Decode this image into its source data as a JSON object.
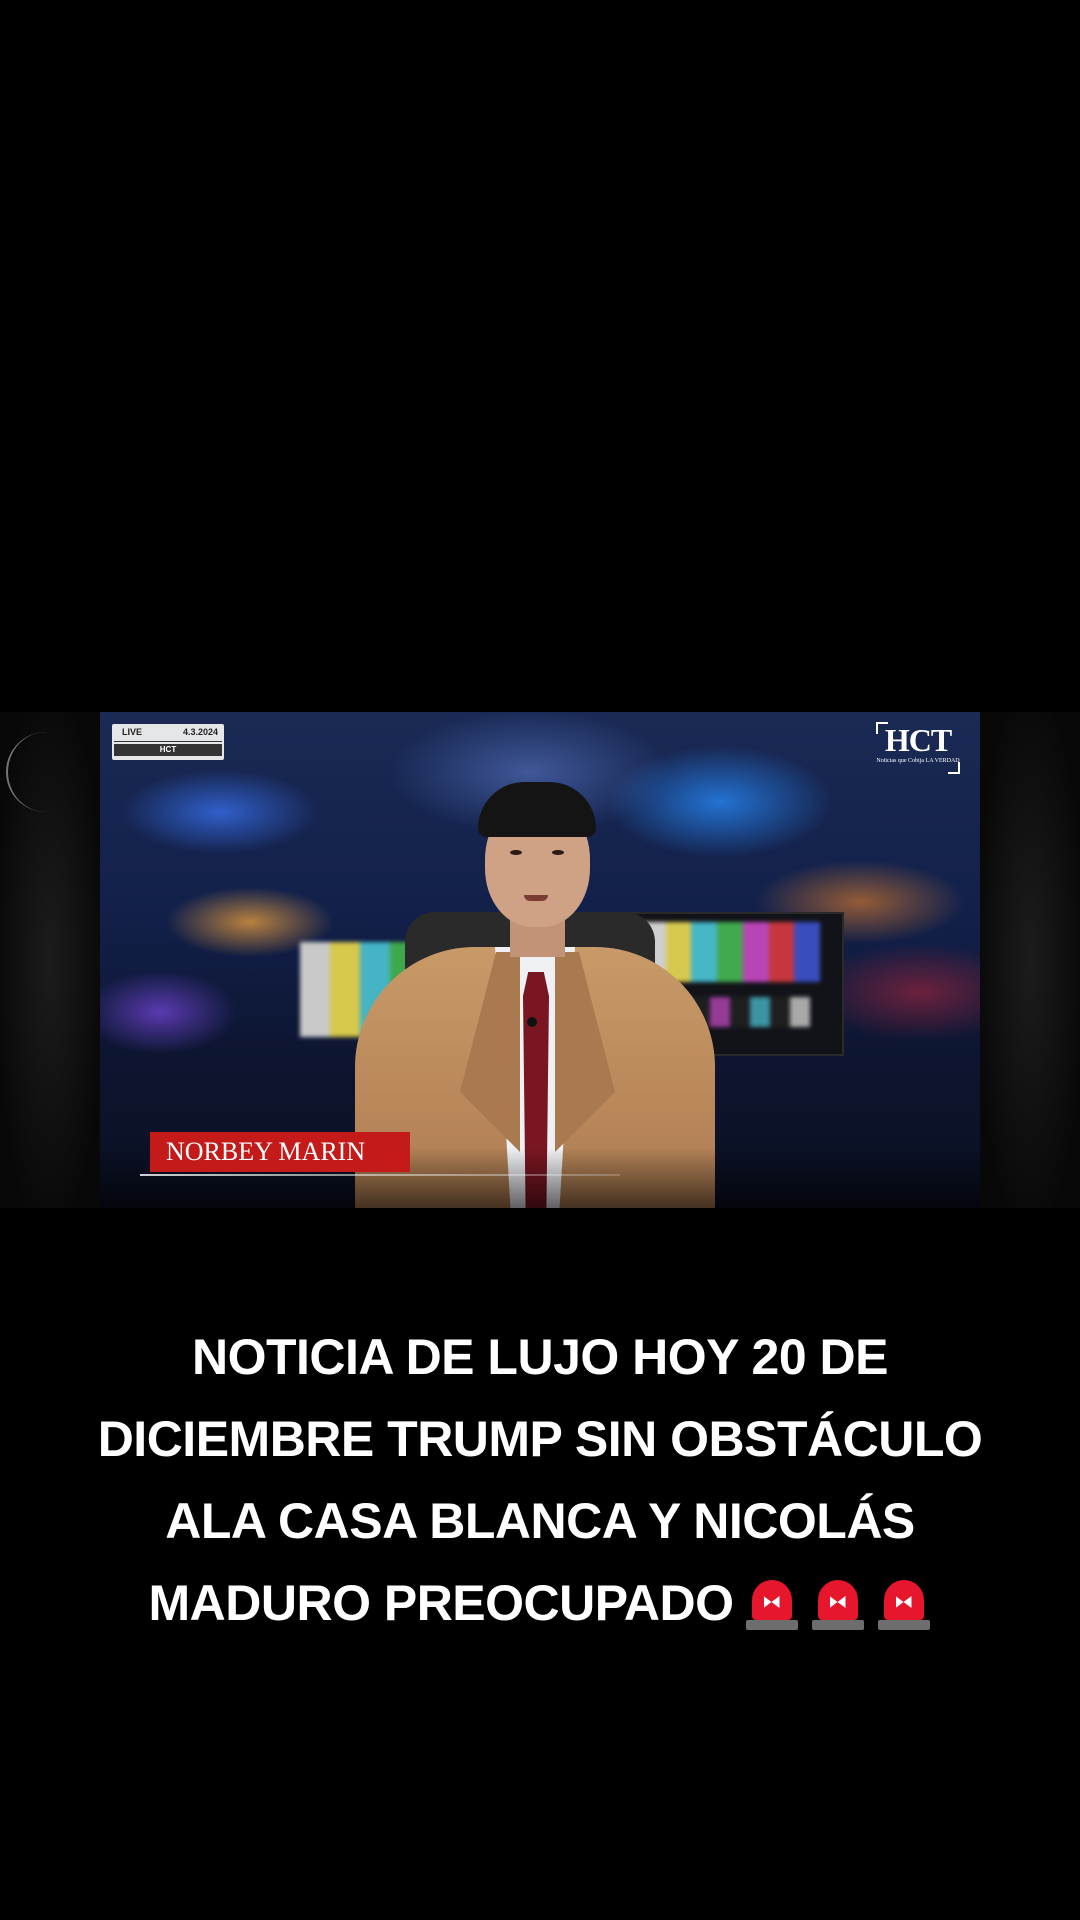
{
  "video": {
    "overlay": {
      "live_label": "LIVE",
      "date": "4.3.2024",
      "station": "HCT"
    },
    "logo": {
      "text": "HCT",
      "subtitle": "Noticias que Cobija LA VERDAD"
    },
    "lower_third": {
      "name": "NORBEY MARIN"
    },
    "colors": {
      "name_plate": "#c51a1a",
      "background": "#000000"
    }
  },
  "caption": {
    "lines": [
      "NOTICIA DE LUJO HOY 20 DE",
      "DICIEMBRE TRUMP SIN OBSTÁCULO",
      "ALA CASA BLANCA Y NICOLÁS",
      "MADURO PREOCUPADO"
    ],
    "trailing_icons": [
      "police-siren-icon",
      "police-siren-icon",
      "police-siren-icon"
    ]
  }
}
